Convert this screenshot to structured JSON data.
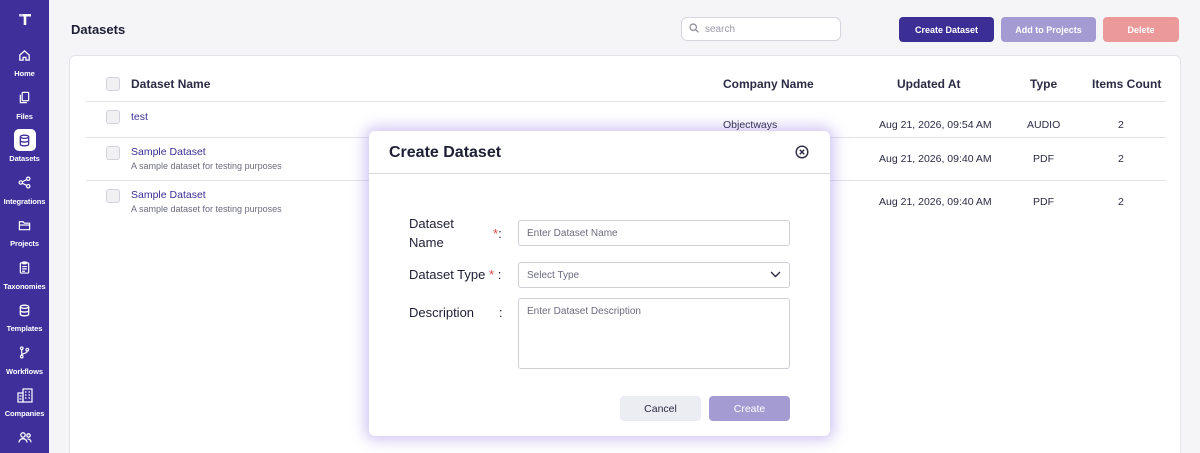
{
  "sidebar": {
    "logo": "T",
    "items": [
      {
        "label": "Home",
        "icon": "home-icon"
      },
      {
        "label": "Files",
        "icon": "files-icon"
      },
      {
        "label": "Datasets",
        "icon": "datasets-icon",
        "active": true
      },
      {
        "label": "Integrations",
        "icon": "integrations-icon"
      },
      {
        "label": "Projects",
        "icon": "folder-icon"
      },
      {
        "label": "Taxonomies",
        "icon": "clipboard-icon"
      },
      {
        "label": "Templates",
        "icon": "templates-icon"
      },
      {
        "label": "Workflows",
        "icon": "workflow-icon"
      },
      {
        "label": "Companies",
        "icon": "building-icon"
      },
      {
        "label": "",
        "icon": "users-icon"
      }
    ]
  },
  "header": {
    "title": "Datasets",
    "search_placeholder": "search",
    "create_label": "Create Dataset",
    "add_label": "Add to Projects",
    "delete_label": "Delete"
  },
  "table": {
    "columns": [
      "Dataset Name",
      "Company Name",
      "Updated At",
      "Type",
      "Items Count"
    ],
    "rows": [
      {
        "name": "test",
        "description": "",
        "company": "Objectways",
        "updated": "Aug 21, 2026, 09:54 AM",
        "type": "AUDIO",
        "count": "2"
      },
      {
        "name": "Sample Dataset",
        "description": "A sample dataset for testing purposes",
        "company": "",
        "updated": "Aug 21, 2026, 09:40 AM",
        "type": "PDF",
        "count": "2"
      },
      {
        "name": "Sample Dataset",
        "description": "A sample dataset for testing purposes",
        "company": "",
        "updated": "Aug 21, 2026, 09:40 AM",
        "type": "PDF",
        "count": "2"
      }
    ]
  },
  "modal": {
    "title": "Create Dataset",
    "name_label_line1": "Dataset",
    "name_label_line2": "Name",
    "name_placeholder": "Enter Dataset Name",
    "type_label": "Dataset Type",
    "type_placeholder": "Select Type",
    "description_label": "Description",
    "description_placeholder": "Enter Dataset Description",
    "required_mark": "*",
    "colon": ":",
    "cancel_label": "Cancel",
    "create_label": "Create"
  },
  "colors": {
    "sidebar": "#3f2f9b",
    "primary": "#3b2f95",
    "primary_disabled": "#a39bd2",
    "danger_disabled": "#eb9a99"
  }
}
